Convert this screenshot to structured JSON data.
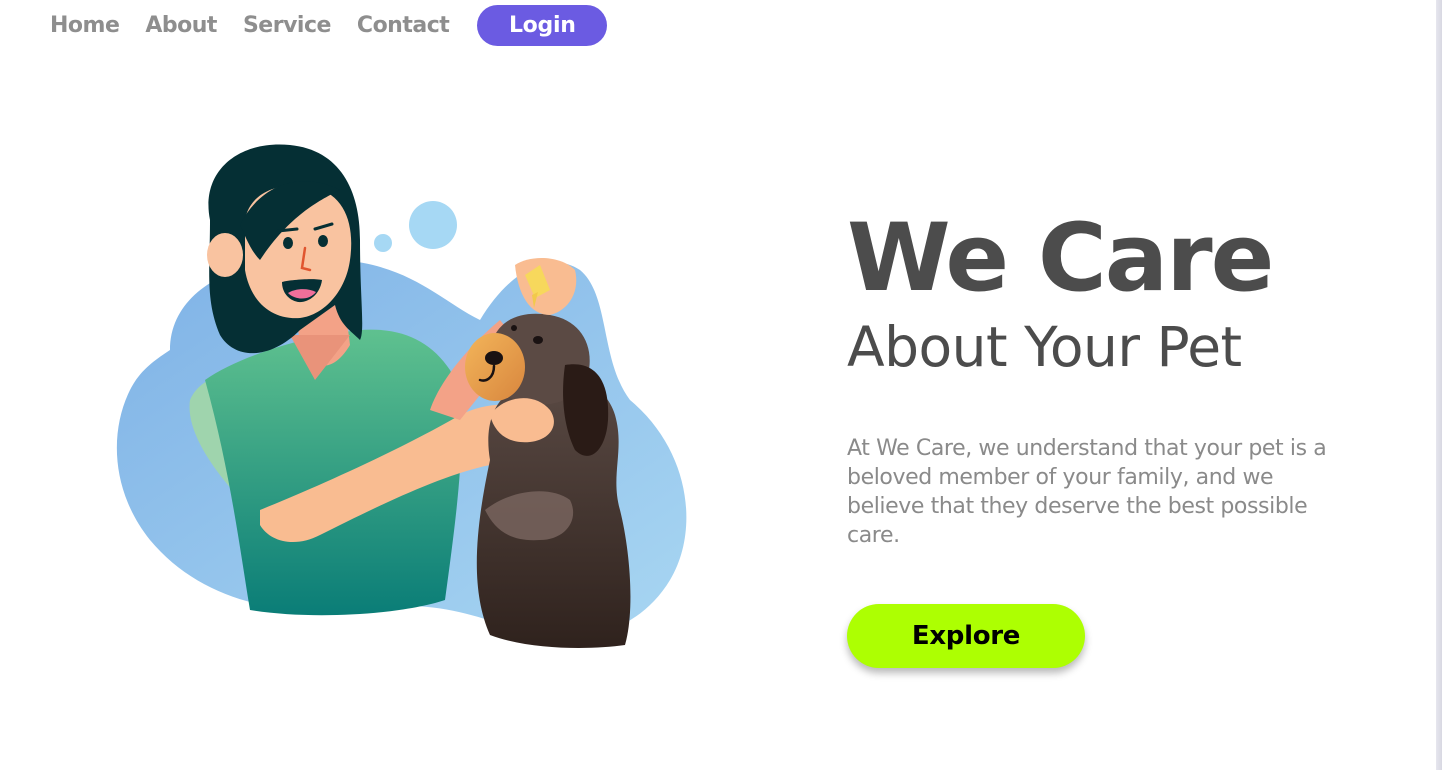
{
  "nav": {
    "links": [
      {
        "label": "Home"
      },
      {
        "label": "About"
      },
      {
        "label": "Service"
      },
      {
        "label": "Contact"
      }
    ],
    "login_label": "Login"
  },
  "hero": {
    "title": "We Care",
    "subtitle": "About Your Pet",
    "description": "At We Care, we understand that your pet is a beloved member of your family, and we believe that they deserve the best possible care.",
    "explore_label": "Explore"
  },
  "colors": {
    "accent": "#6b5be2",
    "explore": "#adff02",
    "heading": "#4c4c4c",
    "body_text": "#8a8a8a",
    "nav_text": "#8e8e8e"
  },
  "illustration": {
    "subject": "woman-giving-dog-eye-drops"
  }
}
